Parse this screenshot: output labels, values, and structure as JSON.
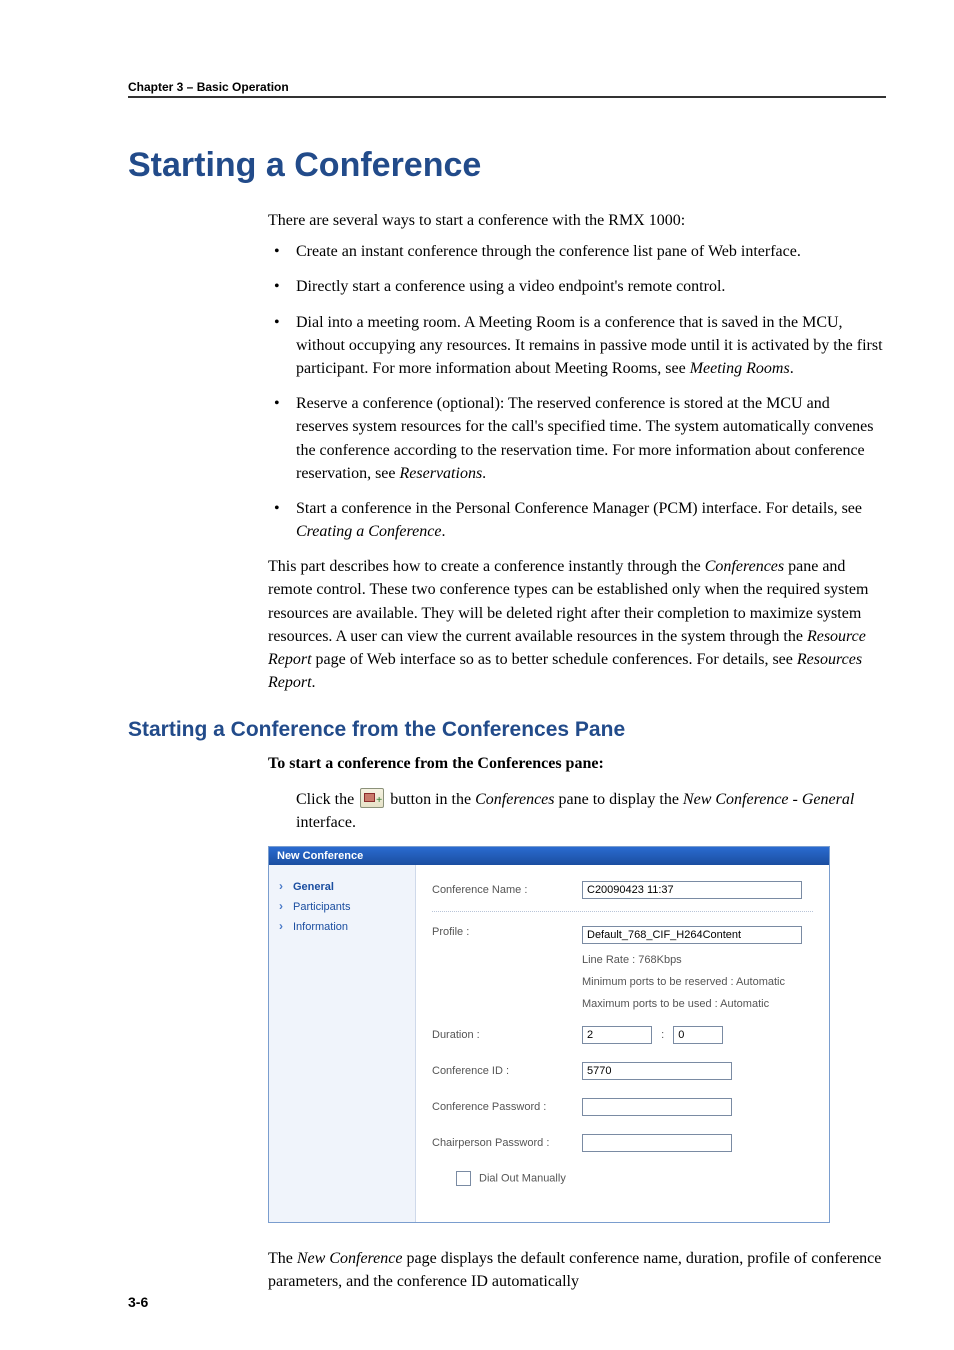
{
  "header": {
    "chapter_line": "Chapter 3 – Basic Operation"
  },
  "title": "Starting a Conference",
  "intro": "There are several ways to start a conference with the RMX 1000:",
  "bullets": [
    {
      "text_a": "Create an instant conference through the conference list pane of Web interface.",
      "tail": ""
    },
    {
      "text_a": "Directly start a conference using a video endpoint's remote control.",
      "tail": ""
    },
    {
      "text_a": "Dial into a meeting room. A Meeting Room is a conference that is saved in the MCU, without occupying any resources. It remains in passive mode until it is activated by the first participant. For more information about Meeting Rooms, see ",
      "em": "Meeting Rooms",
      "tail": "."
    },
    {
      "text_a": "Reserve a conference (optional): The reserved conference is stored at the MCU and reserves system resources for the call's specified time. The system automatically convenes the conference according to the reservation time. For more information about conference reservation, see ",
      "em": "Reservations",
      "tail": "."
    },
    {
      "text_a": "Start a conference in the Personal Conference Manager (PCM) interface. For details, see ",
      "em": "Creating a Conference",
      "tail": "."
    }
  ],
  "post_bullets_a": "This part describes how to create a conference instantly through the ",
  "post_bullets_em1": "Conferences",
  "post_bullets_b": " pane and remote control. These two conference types can be established only when the required system resources are available. They will be deleted right after their completion to maximize system resources. A user can view the current available resources in the system through the ",
  "post_bullets_em2": "Resource Report",
  "post_bullets_c": " page of Web interface so as to better schedule conferences. For details, see ",
  "post_bullets_em3": "Resources Report",
  "post_bullets_d": ".",
  "section2_title": "Starting a Conference from the Conferences Pane",
  "section2_lead_bold": "To start a conference from the Conferences pane:",
  "step_pre": "Click the ",
  "step_mid_a": " button in the ",
  "step_em1": "Conferences",
  "step_mid_b": " pane to display the ",
  "step_em2": "New Conference - General",
  "step_tail": " interface.",
  "dialog": {
    "title": "New Conference",
    "side": {
      "general": "General",
      "participants": "Participants",
      "information": "Information"
    },
    "labels": {
      "conf_name": "Conference Name :",
      "profile": "Profile :",
      "duration": "Duration :",
      "conf_id": "Conference ID :",
      "conf_pw": "Conference Password :",
      "chair_pw": "Chairperson Password :",
      "dial_out": "Dial Out Manually"
    },
    "values": {
      "conf_name": "C20090423 11:37",
      "profile": "Default_768_CIF_H264Content",
      "line_rate": "Line Rate : 768Kbps",
      "min_ports": "Minimum ports to be reserved : Automatic",
      "max_ports": "Maximum ports to be used : Automatic",
      "dur_h": "2",
      "dur_m": "0",
      "conf_id": "5770",
      "conf_pw": "",
      "chair_pw": ""
    }
  },
  "closing_a": "The ",
  "closing_em": "New Conference",
  "closing_b": " page displays the default conference name, duration, profile of conference parameters, and the conference ID automatically",
  "page_number": "3-6"
}
